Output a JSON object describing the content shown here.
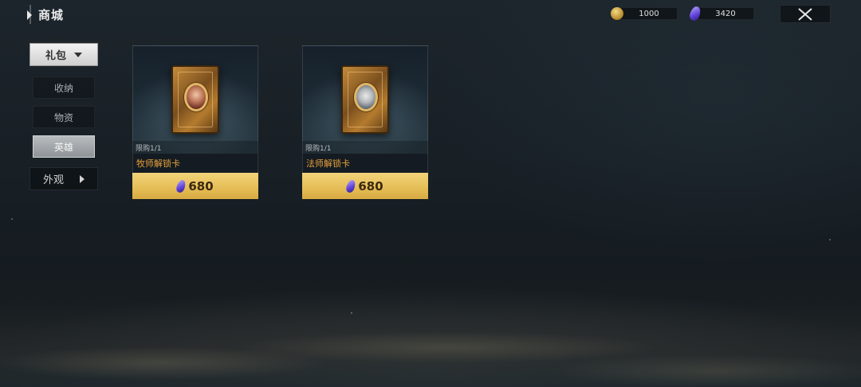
{
  "header": {
    "title": "商城",
    "currencies": [
      {
        "icon": "gold-coin-icon",
        "value": "1000"
      },
      {
        "icon": "purple-gem-icon",
        "value": "3420"
      }
    ],
    "close_icon": "close-icon"
  },
  "sidebar": {
    "dropdown_label": "礼包",
    "items": [
      {
        "label": "收纳",
        "active": false
      },
      {
        "label": "物资",
        "active": false
      },
      {
        "label": "英雄",
        "active": true
      }
    ],
    "appearance_label": "外观"
  },
  "products": [
    {
      "name": "牧师解锁卡",
      "limit": "限购1/1",
      "price": "680",
      "portrait": "priest"
    },
    {
      "name": "法师解锁卡",
      "limit": "限购1/1",
      "price": "680",
      "portrait": "mage"
    }
  ],
  "colors": {
    "accent_gold": "#e5bd55",
    "name_orange": "#e9a23b",
    "active_tab": "#a7abaf"
  }
}
